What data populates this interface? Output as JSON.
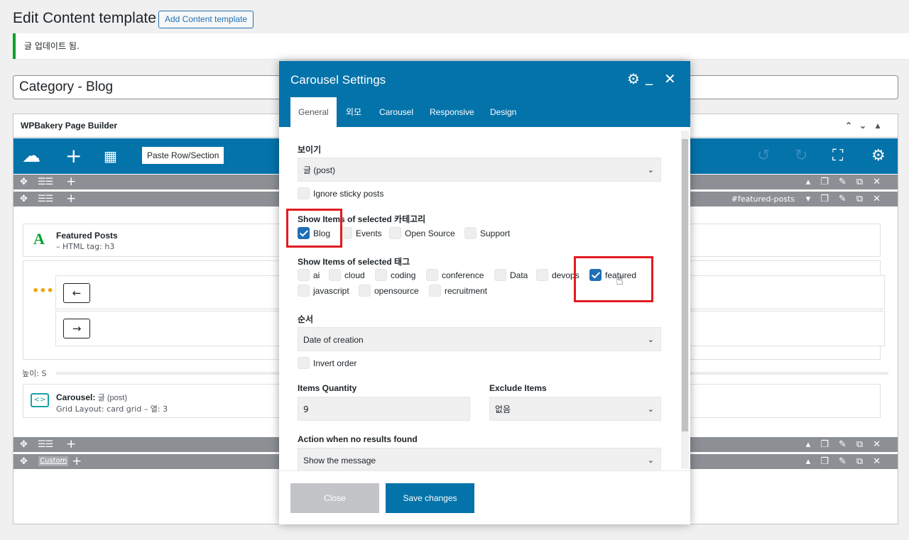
{
  "admin": {
    "page_title": "Edit Content template",
    "add_button": "Add Content template",
    "notice": "글 업데이트 됨.",
    "post_title": "Category - Blog"
  },
  "builder": {
    "title": "WPBakery Page Builder",
    "paste_label": "Paste Row/Section",
    "row_tag": "#featured-posts",
    "custom_label": "Custom",
    "featured": {
      "letter": "A",
      "name": "Featured Posts",
      "sub": "– HTML tag: h3"
    },
    "height_label": "높이: S",
    "carousel_el": {
      "name": "Carousel:",
      "name_rest": "글 (post)",
      "sub": "Grid Layout: card grid – 열: 3"
    },
    "prev_arrow": "←",
    "next_arrow": "→",
    "dots": "•••"
  },
  "modal": {
    "title": "Carousel Settings",
    "tabs": [
      "General",
      "외모",
      "Carousel",
      "Responsive",
      "Design"
    ],
    "active_tab": "General",
    "post_type_label": "보이기",
    "post_type_value": "글 (post)",
    "ignore_sticky": "Ignore sticky posts",
    "category_label": "Show Items of selected 카테고리",
    "categories": [
      {
        "label": "Blog",
        "checked": true
      },
      {
        "label": "Events",
        "checked": false
      },
      {
        "label": "Open Source",
        "checked": false
      },
      {
        "label": "Support",
        "checked": false
      }
    ],
    "tag_label": "Show Items of selected 태그",
    "tags": [
      {
        "label": "ai",
        "checked": false
      },
      {
        "label": "cloud",
        "checked": false
      },
      {
        "label": "coding",
        "checked": false
      },
      {
        "label": "conference",
        "checked": false
      },
      {
        "label": "Data",
        "checked": false
      },
      {
        "label": "devops",
        "checked": false
      },
      {
        "label": "featured",
        "checked": true
      },
      {
        "label": "javascript",
        "checked": false
      },
      {
        "label": "opensource",
        "checked": false
      },
      {
        "label": "recruitment",
        "checked": false
      }
    ],
    "order_label": "순서",
    "order_value": "Date of creation",
    "invert_order": "Invert order",
    "quantity_label": "Items Quantity",
    "quantity_value": "9",
    "exclude_label": "Exclude Items",
    "exclude_value": "없음",
    "no_results_label": "Action when no results found",
    "no_results_value": "Show the message",
    "close_button": "Close",
    "save_button": "Save changes"
  },
  "colors": {
    "brand_blue": "#0473aa",
    "highlight_red": "#e11b22",
    "checkbox_blue": "#1e6fb5"
  }
}
